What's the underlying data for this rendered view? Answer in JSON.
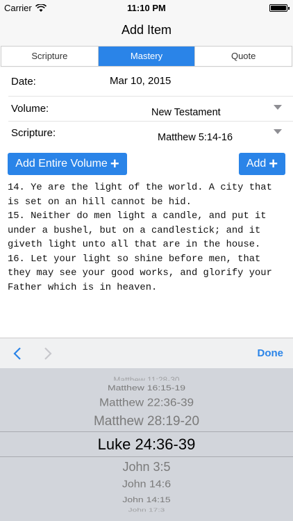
{
  "status_bar": {
    "carrier": "Carrier",
    "time": "11:10 PM"
  },
  "nav": {
    "title": "Add Item"
  },
  "segments": [
    {
      "label": "Scripture",
      "active": false
    },
    {
      "label": "Mastery",
      "active": true
    },
    {
      "label": "Quote",
      "active": false
    }
  ],
  "form": {
    "date_label": "Date:",
    "date_value": "Mar 10, 2015",
    "volume_label": "Volume:",
    "volume_value": "New Testament",
    "scripture_label": "Scripture:",
    "scripture_value": "Matthew 5:14-16"
  },
  "buttons": {
    "add_entire_volume": "Add Entire Volume",
    "add": "Add"
  },
  "scripture_text": "14. Ye are the light of the world. A city that is set on an hill cannot be hid.\n15. Neither do men light a candle, and put it under a bushel, but on a candlestick; and it giveth light unto all that are in the house.\n16. Let your light so shine before men, that they may see your good works, and glorify your Father which is in heaven.",
  "toolbar": {
    "done": "Done"
  },
  "picker": {
    "items": [
      "Matthew 11:28-30",
      "Matthew 16:15-19",
      "Matthew 22:36-39",
      "Matthew 28:19-20",
      "Luke 24:36-39",
      "John 3:5",
      "John 14:6",
      "John 14:15",
      "John 17:3"
    ],
    "selected": "Luke 24:36-39"
  },
  "colors": {
    "accent": "#2a84e8",
    "picker_bg": "#d2d5db"
  },
  "icons": [
    "wifi-icon",
    "battery-icon",
    "chevron-down-icon",
    "plus-icon",
    "chevron-left-icon",
    "chevron-right-icon"
  ]
}
